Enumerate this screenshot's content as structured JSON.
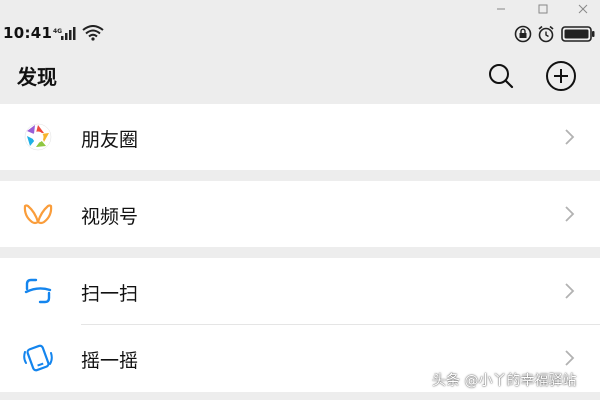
{
  "window": {
    "controls": [
      "minimize-icon",
      "maximize-icon",
      "close-icon"
    ]
  },
  "status_bar": {
    "time": "10:41",
    "network_label": "4G",
    "icons": [
      "signal-icon",
      "wifi-icon",
      "lock-rotation-icon",
      "alarm-icon",
      "battery-icon"
    ]
  },
  "header": {
    "title": "发现",
    "actions": [
      "search-icon",
      "add-icon"
    ]
  },
  "menu": {
    "items": [
      {
        "label": "朋友圈",
        "icon": "moments-icon"
      },
      {
        "label": "视频号",
        "icon": "channels-icon"
      },
      {
        "label": "扫一扫",
        "icon": "scan-icon"
      },
      {
        "label": "摇一摇",
        "icon": "shake-icon"
      }
    ]
  },
  "watermark": "头条 @小丫的幸福驿站",
  "colors": {
    "background": "#ededed",
    "cell": "#ffffff",
    "channels_accent": "#fa9d3b",
    "scan_accent": "#1485ee",
    "chevron": "#b2b2b2"
  }
}
